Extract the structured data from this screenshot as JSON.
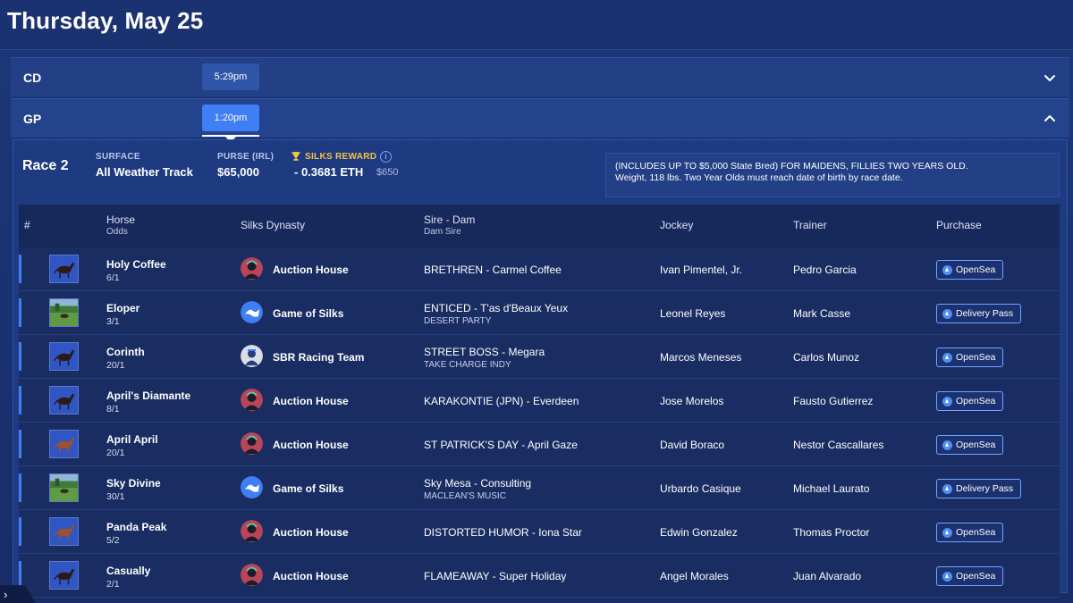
{
  "page": {
    "date_title": "Thursday, May 25"
  },
  "tracks": [
    {
      "code": "CD",
      "time": "5:29pm",
      "expanded": false
    },
    {
      "code": "GP",
      "time": "1:20pm",
      "expanded": true
    }
  ],
  "race": {
    "title": "Race 2",
    "surface_label": "SURFACE",
    "surface_value": "All Weather Track",
    "purse_label": "PURSE (IRL)",
    "purse_value": "$65,000",
    "reward_label": "SILKS REWARD",
    "reward_eth": "- 0.3681 ETH",
    "reward_usd": "$650",
    "conditions_line1": "(INCLUDES UP TO $5,000 State Bred) FOR MAIDENS, FILLIES TWO YEARS OLD.",
    "conditions_line2": "Weight, 118 lbs. Two Year Olds must reach date of birth by race date."
  },
  "table": {
    "headers": {
      "num": "#",
      "horse": "Horse",
      "odds": "Odds",
      "dynasty": "Silks Dynasty",
      "sire_dam": "Sire - Dam",
      "dam_sire": "Dam Sire",
      "jockey": "Jockey",
      "trainer": "Trainer",
      "purchase": "Purchase"
    },
    "rows": [
      {
        "horse": "Holy Coffee",
        "odds": "6/1",
        "thumb": "dark-horse",
        "dynasty": "Auction House",
        "dynasty_icon": "auction-house",
        "sire_dam": "BRETHREN - Carmel Coffee",
        "dam_sire": "",
        "jockey": "Ivan Pimentel, Jr.",
        "trainer": "Pedro Garcia",
        "purchase": "OpenSea"
      },
      {
        "horse": "Eloper",
        "odds": "3/1",
        "thumb": "pasture",
        "dynasty": "Game of Silks",
        "dynasty_icon": "game-of-silks",
        "sire_dam": "ENTICED - T'as d'Beaux Yeux",
        "dam_sire": "DESERT PARTY",
        "jockey": "Leonel Reyes",
        "trainer": "Mark Casse",
        "purchase": "Delivery Pass"
      },
      {
        "horse": "Corinth",
        "odds": "20/1",
        "thumb": "dark-horse",
        "dynasty": "SBR Racing Team",
        "dynasty_icon": "sbr-racing",
        "sire_dam": "STREET BOSS - Megara",
        "dam_sire": "TAKE CHARGE INDY",
        "jockey": "Marcos Meneses",
        "trainer": "Carlos Munoz",
        "purchase": "OpenSea"
      },
      {
        "horse": "April's Diamante",
        "odds": "8/1",
        "thumb": "dark-horse",
        "dynasty": "Auction House",
        "dynasty_icon": "auction-house",
        "sire_dam": "KARAKONTIE (JPN) - Everdeen",
        "dam_sire": "",
        "jockey": "Jose Morelos",
        "trainer": "Fausto Gutierrez",
        "purchase": "OpenSea"
      },
      {
        "horse": "April April",
        "odds": "20/1",
        "thumb": "chestnut-horse",
        "dynasty": "Auction House",
        "dynasty_icon": "auction-house",
        "sire_dam": "ST PATRICK'S DAY - April Gaze",
        "dam_sire": "",
        "jockey": "David Boraco",
        "trainer": "Nestor Cascallares",
        "purchase": "OpenSea"
      },
      {
        "horse": "Sky Divine",
        "odds": "30/1",
        "thumb": "pasture",
        "dynasty": "Game of Silks",
        "dynasty_icon": "game-of-silks",
        "sire_dam": "Sky Mesa - Consulting",
        "dam_sire": "MACLEAN'S MUSIC",
        "jockey": "Urbardo Casique",
        "trainer": "Michael Laurato",
        "purchase": "Delivery Pass"
      },
      {
        "horse": "Panda Peak",
        "odds": "5/2",
        "thumb": "chestnut-horse",
        "dynasty": "Auction House",
        "dynasty_icon": "auction-house",
        "sire_dam": "DISTORTED HUMOR - Iona Star",
        "dam_sire": "",
        "jockey": "Edwin Gonzalez",
        "trainer": "Thomas Proctor",
        "purchase": "OpenSea"
      },
      {
        "horse": "Casually",
        "odds": "2/1",
        "thumb": "dark-horse",
        "dynasty": "Auction House",
        "dynasty_icon": "auction-house",
        "sire_dam": "FLAMEAWAY - Super Holiday",
        "dam_sire": "",
        "jockey": "Angel Morales",
        "trainer": "Juan Alvarado",
        "purchase": "OpenSea"
      }
    ]
  },
  "colors": {
    "accent": "#3f7ef5",
    "reward": "#f5c542",
    "background": "#1d3777"
  }
}
